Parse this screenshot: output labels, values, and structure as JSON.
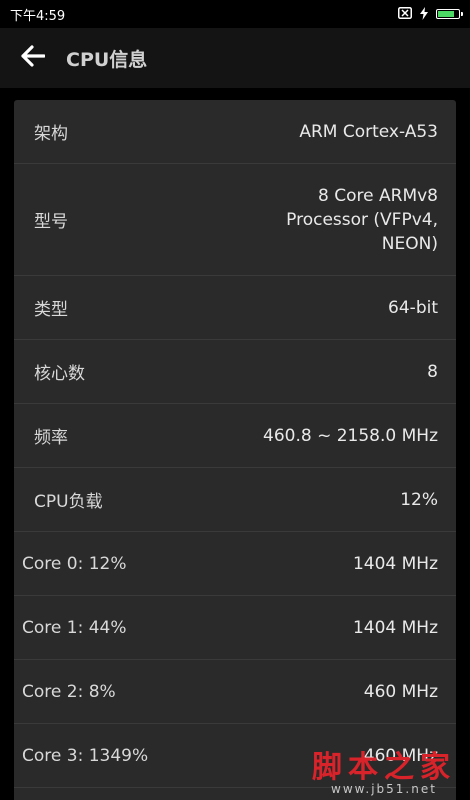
{
  "status_bar": {
    "time": "下午4:59",
    "battery_level": 0.85,
    "icons": [
      "notification-off-icon",
      "charging-icon",
      "battery-icon"
    ]
  },
  "app_bar": {
    "title": "CPU信息",
    "back_icon": "arrow-left-icon"
  },
  "rows": [
    {
      "label": "架构",
      "value": "ARM Cortex-A53"
    },
    {
      "label": "型号",
      "value": "8 Core ARMv8\nProcessor (VFPv4,\nNEON)"
    },
    {
      "label": "类型",
      "value": "64-bit"
    },
    {
      "label": "核心数",
      "value": "8"
    },
    {
      "label": "频率",
      "value": "460.8 ~ 2158.0 MHz"
    },
    {
      "label": "CPU负载",
      "value": "12%"
    }
  ],
  "cores": [
    {
      "label": "Core 0: 12%",
      "value": "1404 MHz"
    },
    {
      "label": "Core 1: 44%",
      "value": "1404 MHz"
    },
    {
      "label": "Core 2: 8%",
      "value": "460 MHz"
    },
    {
      "label": "Core 3: 1349%",
      "value": "460 MHz"
    }
  ],
  "watermark": {
    "main": "脚本之家",
    "url": "www.jb51.net"
  },
  "colors": {
    "background": "#000000",
    "app_bar": "#141414",
    "card": "#2a2a2a",
    "divider": "#3a3a3a",
    "watermark_red": "#d8232a"
  }
}
